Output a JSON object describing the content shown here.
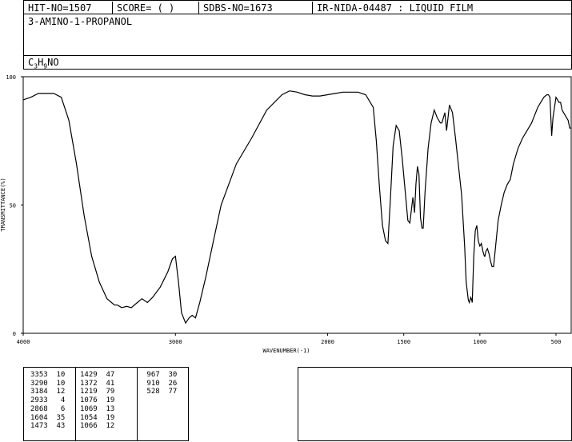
{
  "header": {
    "hit_no": "HIT-NO=1507",
    "score": "SCORE=  (  )",
    "sdbs_no": "SDBS-NO=1673",
    "ir_code": "IR-NIDA-04487 : LIQUID FILM"
  },
  "compound_name": "3-AMINO-1-PROPANOL",
  "formula": {
    "c": "C",
    "c_sub": "3",
    "h": "H",
    "h_sub": "9",
    "rest": "NO"
  },
  "chart_data": {
    "type": "line",
    "xlabel": "WAVENUMBER(-1)",
    "ylabel": "TRANSMITTANCE(%)",
    "xlim": [
      4000,
      400
    ],
    "ylim": [
      0,
      100
    ],
    "x_reversed": true,
    "x_ticks": [
      4000,
      3000,
      2000,
      1500,
      1000,
      500
    ],
    "y_ticks": [
      0,
      50,
      100
    ],
    "x_tick_labels": [
      "4000",
      "3000",
      "2000",
      "1500",
      "1000",
      "500"
    ],
    "y_tick_labels": [
      "0",
      "50",
      "100"
    ],
    "series": [
      {
        "x": [
          4000,
          3950,
          3900,
          3850,
          3800,
          3750,
          3700,
          3650,
          3600,
          3550,
          3500,
          3450,
          3400,
          3380,
          3353,
          3320,
          3290,
          3250,
          3220,
          3184,
          3150,
          3100,
          3050,
          3020,
          3000,
          2980,
          2960,
          2933,
          2910,
          2890,
          2868,
          2840,
          2800,
          2750,
          2700,
          2600,
          2500,
          2400,
          2300,
          2250,
          2200,
          2150,
          2100,
          2050,
          2000,
          1950,
          1900,
          1850,
          1800,
          1750,
          1700,
          1680,
          1660,
          1640,
          1620,
          1604,
          1590,
          1570,
          1550,
          1530,
          1510,
          1490,
          1473,
          1460,
          1450,
          1440,
          1429,
          1420,
          1410,
          1400,
          1390,
          1380,
          1372,
          1360,
          1340,
          1320,
          1300,
          1280,
          1260,
          1250,
          1240,
          1230,
          1219,
          1200,
          1180,
          1160,
          1140,
          1120,
          1100,
          1090,
          1076,
          1069,
          1060,
          1054,
          1050,
          1040,
          1030,
          1020,
          1010,
          1000,
          990,
          980,
          970,
          967,
          960,
          950,
          940,
          930,
          920,
          910,
          900,
          880,
          860,
          840,
          820,
          800,
          780,
          750,
          720,
          700,
          680,
          660,
          640,
          620,
          600,
          580,
          560,
          550,
          540,
          528,
          520,
          510,
          500,
          490,
          480,
          470,
          460,
          450,
          440,
          430,
          420,
          410,
          400
        ],
        "y": [
          91,
          92,
          93.5,
          93.5,
          93.5,
          92,
          83,
          66,
          46,
          30,
          20,
          13.5,
          11,
          11,
          10,
          10.5,
          10,
          12,
          13.5,
          12,
          14,
          18,
          24,
          29,
          30,
          20,
          8,
          4,
          6,
          7,
          6,
          12,
          22,
          36,
          50,
          66,
          76,
          87,
          93,
          94.5,
          94,
          93,
          92.5,
          92.5,
          93,
          93.5,
          94,
          94,
          94,
          93,
          88,
          75,
          57,
          42,
          36,
          35,
          50,
          73,
          81,
          79,
          68,
          55,
          44,
          43,
          48,
          53,
          47,
          58,
          65,
          62,
          45,
          41,
          41,
          55,
          72,
          82,
          87,
          84,
          82,
          82,
          84,
          86,
          79,
          89,
          86,
          76,
          65,
          54,
          34,
          20,
          13,
          12,
          14,
          13,
          12,
          30,
          40,
          42,
          36,
          34,
          35,
          32,
          30,
          30,
          32,
          33,
          31,
          28,
          26,
          26,
          32,
          44,
          50,
          55,
          58,
          60,
          66,
          72,
          76,
          78,
          80,
          82,
          85,
          88,
          90,
          92,
          93,
          93,
          92,
          77,
          84,
          88,
          92,
          91,
          90,
          90,
          87,
          86,
          85,
          84,
          83,
          80,
          80
        ]
      }
    ]
  },
  "peaks": {
    "col1": [
      "3353  10",
      "3290  10",
      "3184  12",
      "2933   4",
      "2868   6",
      "1604  35",
      "1473  43"
    ],
    "col2": [
      "1429  47",
      "1372  41",
      "1219  79",
      "1076  19",
      "1069  13",
      "1054  19",
      "1066  12"
    ],
    "col3": [
      " 967  30",
      " 910  26",
      " 528  77"
    ]
  }
}
